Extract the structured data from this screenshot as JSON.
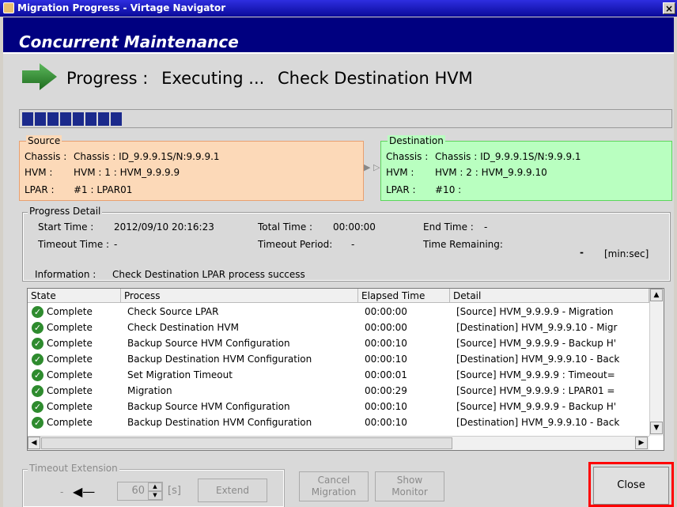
{
  "window": {
    "title": "Migration Progress - Virtage Navigator",
    "close_glyph": "×"
  },
  "header": {
    "title": "Concurrent Maintenance"
  },
  "progress": {
    "label": "Progress :",
    "status": "Executing ...",
    "step": "Check Destination HVM",
    "segments_filled": 8
  },
  "source": {
    "legend": "Source",
    "chassis_label": "Chassis :",
    "chassis_value": "Chassis : ID_9.9.9.1S/N:9.9.9.1",
    "hvm_label": "HVM :",
    "hvm_value": "HVM : 1 : HVM_9.9.9.9",
    "lpar_label": "LPAR :",
    "lpar_value": "#1 : LPAR01"
  },
  "destination": {
    "legend": "Destination",
    "chassis_label": "Chassis :",
    "chassis_value": "Chassis : ID_9.9.9.1S/N:9.9.9.1",
    "hvm_label": "HVM :",
    "hvm_value": "HVM : 2 : HVM_9.9.9.10",
    "lpar_label": "LPAR :",
    "lpar_value": "#10 :"
  },
  "detail": {
    "legend": "Progress Detail",
    "start_label": "Start Time :",
    "start_value": "2012/09/10 20:16:23",
    "total_label": "Total Time :",
    "total_value": "00:00:00",
    "end_label": "End Time :",
    "end_value": "-",
    "timeout_label": "Timeout Time :",
    "timeout_value": "-",
    "period_label": "Timeout Period:",
    "period_value": "-",
    "remaining_label": "Time Remaining:",
    "remaining_value": "-",
    "remaining_unit": "[min:sec]",
    "info_label": "Information :",
    "info_value": "Check Destination LPAR process success"
  },
  "table": {
    "columns": [
      "State",
      "Process",
      "Elapsed Time",
      "Detail"
    ],
    "rows": [
      {
        "state": "Complete",
        "process": "Check Source LPAR",
        "elapsed": "00:00:00",
        "detail": "[Source] HVM_9.9.9.9 - Migration"
      },
      {
        "state": "Complete",
        "process": "Check Destination HVM",
        "elapsed": "00:00:00",
        "detail": "[Destination] HVM_9.9.9.10 - Migr"
      },
      {
        "state": "Complete",
        "process": "Backup Source HVM Configuration",
        "elapsed": "00:00:10",
        "detail": "[Source] HVM_9.9.9.9 - Backup H'"
      },
      {
        "state": "Complete",
        "process": "Backup Destination HVM Configuration",
        "elapsed": "00:00:10",
        "detail": "[Destination] HVM_9.9.9.10 - Back"
      },
      {
        "state": "Complete",
        "process": "Set Migration Timeout",
        "elapsed": "00:00:01",
        "detail": "[Source] HVM_9.9.9.9 : Timeout="
      },
      {
        "state": "Complete",
        "process": "Migration",
        "elapsed": "00:00:29",
        "detail": "[Source] HVM_9.9.9.9 : LPAR01 ="
      },
      {
        "state": "Complete",
        "process": "Backup Source HVM Configuration",
        "elapsed": "00:00:10",
        "detail": "[Source] HVM_9.9.9.9 - Backup H'"
      },
      {
        "state": "Complete",
        "process": "Backup Destination HVM Configuration",
        "elapsed": "00:00:10",
        "detail": "[Destination] HVM_9.9.9.10 - Back"
      }
    ]
  },
  "timeout_ext": {
    "legend": "Timeout Extension",
    "dash": "-",
    "value": "60",
    "unit": "[s]",
    "extend_label": "Extend"
  },
  "buttons": {
    "cancel_l1": "Cancel",
    "cancel_l2": "Migration",
    "show_l1": "Show",
    "show_l2": "Monitor",
    "close": "Close"
  }
}
